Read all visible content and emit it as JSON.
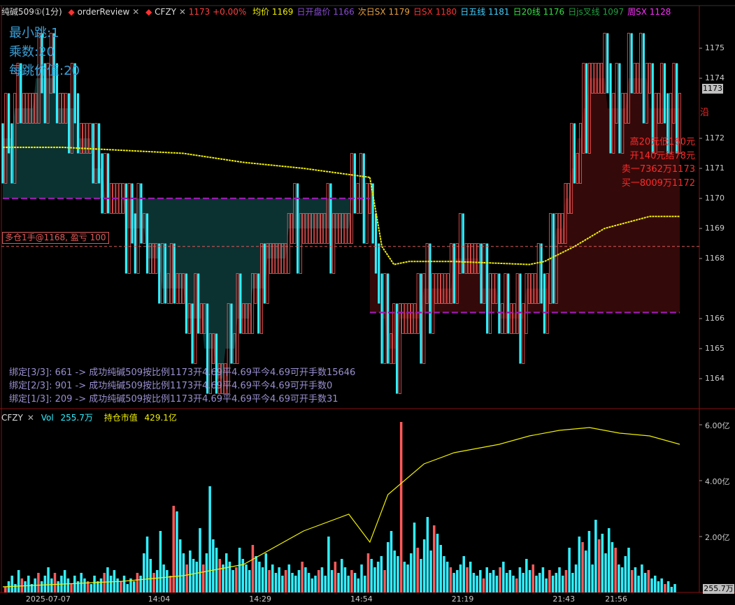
{
  "header": {
    "symbol": "纯碱509①(1分)",
    "tab1": "orderReview",
    "tab2": "CFZY",
    "close_glyph": "✕",
    "dot_glyph": "◆",
    "quote": "1173 +0.00%",
    "indicators": [
      {
        "label": "均价",
        "value": "1169",
        "color": "#f0f000"
      },
      {
        "label": "日开盘价",
        "value": "1166",
        "color": "#8a4bd6"
      },
      {
        "label": "次日SX",
        "value": "1179",
        "color": "#e8a040"
      },
      {
        "label": "日SX",
        "value": "1180",
        "color": "#ff3030"
      },
      {
        "label": "日五线",
        "value": "1181",
        "color": "#40d0ff"
      },
      {
        "label": "日20线",
        "value": "1176",
        "color": "#30e040"
      },
      {
        "label": "日js叉线",
        "value": "1097",
        "color": "#20a040"
      },
      {
        "label": "周SX",
        "value": "1128",
        "color": "#ff30ff"
      }
    ]
  },
  "info_left": [
    "最小跳:1",
    "乘数:20",
    "每跳价值:20"
  ],
  "info_right": [
    "高20元低160元",
    "开140元结78元",
    "卖一7362万1173",
    "买一8009万1172"
  ],
  "side_marker": "沿",
  "position_label": "多仓1手@1168, 盈亏 100",
  "bindings": [
    "绑定[3/3]:  661 -> 成功纯碱509按比例1173开4.69平4.69平今4.69可开手数15646",
    "绑定[2/3]:  901 -> 成功纯碱509按比例1173开4.69平4.69平今4.69可开手数0",
    "绑定[1/3]:  209 -> 成功纯碱509按比例1173开4.69平4.69平今4.69可开手数31"
  ],
  "price_axis": [
    "1175",
    "1174",
    "1172",
    "1171",
    "1170",
    "1169",
    "1168",
    "1166",
    "1165",
    "1164"
  ],
  "current_price": "1173",
  "volume_header": {
    "name": "CFZY",
    "vol_label": "Vol",
    "vol_value": "255.7万",
    "oi_label": "持仓市值",
    "oi_value": "429.1亿"
  },
  "volume_axis": [
    "6.00亿",
    "4.00亿",
    "2.00亿"
  ],
  "current_volume": "255.7万",
  "time_axis": [
    "2025-07-07",
    "14:04",
    "14:29",
    "14:54",
    "21:19",
    "21:43",
    "21:56"
  ],
  "colors": {
    "up": "#ff5a5a",
    "down": "#30f0ff",
    "avg": "#f0f000",
    "open_line": "#8a1a9a",
    "dark_fill": "#0e3a3a",
    "red_fill": "#3a0a0a",
    "grid": "#8a1010"
  },
  "chart_data": [
    {
      "type": "line",
      "title": "",
      "x_range_minutes": [
        0,
        225
      ],
      "ylim": [
        1163,
        1176
      ],
      "yticks": [
        1175,
        1174,
        1172,
        1171,
        1170,
        1169,
        1168,
        1166,
        1165,
        1164
      ],
      "series": [
        {
          "name": "均价",
          "points": [
            [
              0,
              1171.7
            ],
            [
              20,
              1171.7
            ],
            [
              40,
              1171.6
            ],
            [
              60,
              1171.5
            ],
            [
              80,
              1171.2
            ],
            [
              100,
              1171.0
            ],
            [
              122,
              1170.7
            ],
            [
              126,
              1168.4
            ],
            [
              130,
              1167.8
            ],
            [
              135,
              1167.9
            ],
            [
              150,
              1167.9
            ],
            [
              175,
              1167.8
            ],
            [
              180,
              1167.9
            ],
            [
              190,
              1168.4
            ],
            [
              200,
              1169.0
            ],
            [
              215,
              1169.4
            ],
            [
              225,
              1169.4
            ]
          ]
        },
        {
          "name": "日开盘价",
          "points": [
            [
              0,
              1170
            ],
            [
              122,
              1170
            ]
          ]
        },
        {
          "name": "日开盘价",
          "points": [
            [
              122,
              1166.2
            ],
            [
              225,
              1166.2
            ]
          ]
        }
      ],
      "price_path": [
        [
          0,
          1172
        ],
        [
          8,
          1173
        ],
        [
          14,
          1174
        ],
        [
          20,
          1173
        ],
        [
          28,
          1172
        ],
        [
          35,
          1170
        ],
        [
          45,
          1169
        ],
        [
          55,
          1167
        ],
        [
          65,
          1166
        ],
        [
          72,
          1164
        ],
        [
          80,
          1166
        ],
        [
          90,
          1168
        ],
        [
          100,
          1169
        ],
        [
          110,
          1169
        ],
        [
          122,
          1170
        ],
        [
          125,
          1167
        ],
        [
          128,
          1165
        ],
        [
          135,
          1166
        ],
        [
          145,
          1167
        ],
        [
          155,
          1168
        ],
        [
          168,
          1166
        ],
        [
          180,
          1167
        ],
        [
          190,
          1171
        ],
        [
          196,
          1174
        ],
        [
          205,
          1173
        ],
        [
          210,
          1174
        ],
        [
          218,
          1173
        ],
        [
          225,
          1173
        ]
      ]
    },
    {
      "type": "bar",
      "title": "",
      "ylim": [
        0,
        6.0
      ],
      "yticks": [
        6.0,
        4.0,
        2.0
      ],
      "volume_units": "亿",
      "values": [
        0.2,
        0.4,
        0.6,
        0.3,
        0.8,
        0.5,
        0.4,
        0.6,
        0.3,
        0.5,
        0.7,
        0.4,
        0.6,
        0.9,
        0.5,
        0.7,
        0.4,
        0.6,
        0.8,
        0.5,
        0.3,
        0.6,
        0.4,
        0.7,
        0.5,
        0.4,
        0.3,
        0.6,
        0.4,
        0.5,
        0.7,
        0.9,
        0.6,
        0.8,
        0.5,
        0.4,
        0.6,
        0.3,
        0.5,
        0.4,
        0.7,
        0.6,
        1.4,
        2.0,
        1.2,
        0.7,
        0.8,
        2.2,
        1.0,
        0.8,
        0.6,
        3.1,
        2.9,
        1.9,
        1.4,
        1.0,
        1.5,
        1.2,
        1.1,
        2.3,
        1.0,
        1.4,
        3.8,
        1.9,
        1.6,
        1.2,
        1.0,
        1.4,
        1.1,
        0.8,
        0.9,
        1.6,
        1.2,
        1.0,
        0.8,
        1.7,
        1.3,
        1.1,
        0.9,
        1.4,
        0.8,
        1.0,
        0.7,
        0.9,
        0.6,
        0.8,
        1.0,
        0.7,
        0.6,
        0.8,
        1.1,
        0.9,
        0.7,
        0.5,
        0.6,
        0.8,
        0.9,
        0.6,
        2.0,
        0.8,
        1.1,
        0.7,
        1.2,
        0.9,
        0.6,
        0.8,
        0.7,
        0.5,
        1.0,
        0.6,
        1.4,
        1.2,
        0.9,
        1.1,
        1.3,
        0.8,
        1.8,
        2.2,
        1.5,
        1.3,
        6.1,
        1.1,
        1.0,
        1.4,
        2.5,
        1.6,
        1.2,
        1.9,
        2.7,
        1.5,
        2.4,
        2.1,
        1.7,
        1.3,
        1.1,
        0.9,
        0.7,
        0.8,
        1.0,
        1.3,
        0.9,
        1.1,
        0.7,
        0.6,
        0.8,
        0.5,
        0.9,
        0.7,
        0.8,
        0.6,
        0.9,
        1.1,
        0.7,
        0.8,
        0.6,
        0.5,
        0.9,
        0.7,
        1.2,
        0.8,
        1.0,
        0.6,
        0.7,
        0.9,
        0.5,
        0.8,
        0.6,
        0.7,
        0.9,
        0.6,
        0.8,
        1.6,
        0.7,
        1.0,
        2.0,
        1.8,
        1.5,
        2.2,
        1.0,
        2.6,
        1.9,
        2.1,
        1.4,
        2.3,
        1.8,
        1.6,
        1.0,
        0.9,
        1.3,
        1.6,
        0.8,
        0.9,
        0.6,
        1.0,
        0.7,
        0.8,
        0.5,
        0.6,
        0.4,
        0.5,
        0.3,
        0.4,
        0.2,
        0.3
      ],
      "open_interest_line": [
        [
          0,
          0.2
        ],
        [
          20,
          0.3
        ],
        [
          40,
          0.4
        ],
        [
          60,
          0.6
        ],
        [
          80,
          1.0
        ],
        [
          100,
          2.2
        ],
        [
          115,
          2.8
        ],
        [
          122,
          1.8
        ],
        [
          128,
          3.5
        ],
        [
          140,
          4.6
        ],
        [
          150,
          5.0
        ],
        [
          165,
          5.3
        ],
        [
          175,
          5.6
        ],
        [
          185,
          5.8
        ],
        [
          195,
          5.9
        ],
        [
          205,
          5.7
        ],
        [
          215,
          5.6
        ],
        [
          225,
          5.3
        ]
      ]
    }
  ]
}
